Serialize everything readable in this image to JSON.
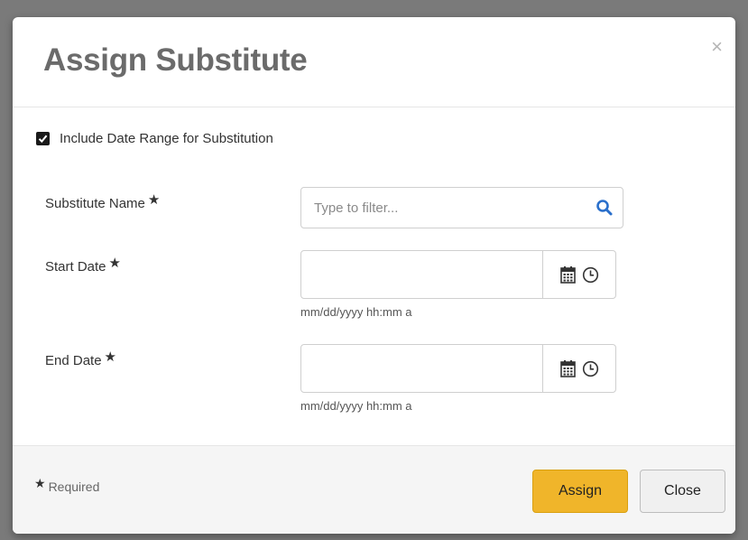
{
  "dialog": {
    "title": "Assign Substitute",
    "close_symbol": "×"
  },
  "form": {
    "include_date_range": {
      "label": "Include Date Range for Substitution",
      "checked": true
    },
    "substitute_name": {
      "label": "Substitute Name",
      "required_mark": "★",
      "placeholder": "Type to filter...",
      "value": "",
      "icon": "search-icon"
    },
    "start_date": {
      "label": "Start Date",
      "required_mark": "★",
      "value": "",
      "hint": "mm/dd/yyyy hh:mm a",
      "icons": [
        "calendar-icon",
        "clock-icon"
      ]
    },
    "end_date": {
      "label": "End Date",
      "required_mark": "★",
      "value": "",
      "hint": "mm/dd/yyyy hh:mm a",
      "icons": [
        "calendar-icon",
        "clock-icon"
      ]
    }
  },
  "footer": {
    "required_mark": "★",
    "required_note": "Required",
    "assign_label": "Assign",
    "close_label": "Close"
  },
  "colors": {
    "assign_button": "#f0b52a",
    "search_icon": "#2a6fcb",
    "title": "#6b6b6b"
  }
}
